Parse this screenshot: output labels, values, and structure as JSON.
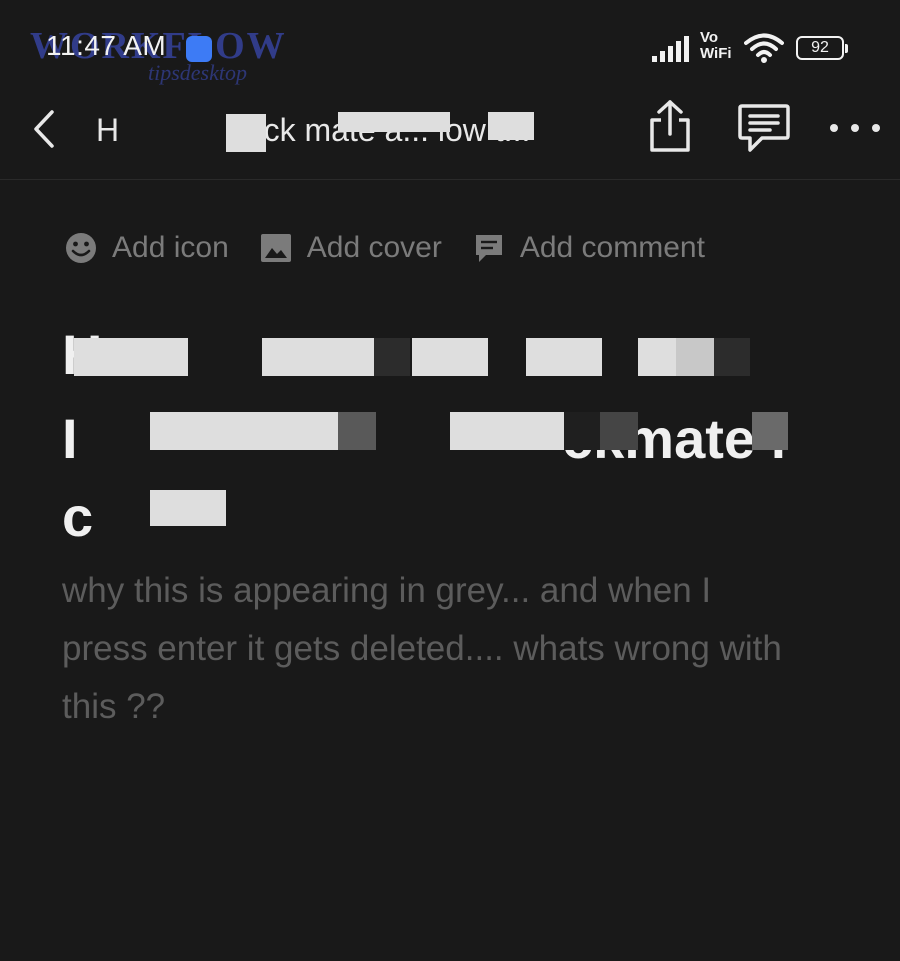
{
  "status": {
    "time": "11:47 AM",
    "watermark": "WORKFLOW",
    "watermark_sub": "tipsdesktop",
    "vowifi_top": "Vo",
    "vowifi_bottom": "WiFi",
    "battery": "92"
  },
  "nav": {
    "crumb": "H",
    "title_visible": "neck mate a... low t..."
  },
  "doc_actions": {
    "add_icon": "Add icon",
    "add_cover": "Add cover",
    "add_comment": "Add comment"
  },
  "page": {
    "title_line_1": "H",
    "title_line_2": "I",
    "title_line_2_tail": "ckmate in",
    "title_line_3": "c",
    "body": "why this is appearing in grey... and when I press enter it gets deleted.... whats wrong with this ??"
  },
  "colors": {
    "background": "#191919",
    "text_primary": "#f0f0f0",
    "text_muted": "#7b7b7b",
    "placeholder_text": "#5c5c5c"
  }
}
